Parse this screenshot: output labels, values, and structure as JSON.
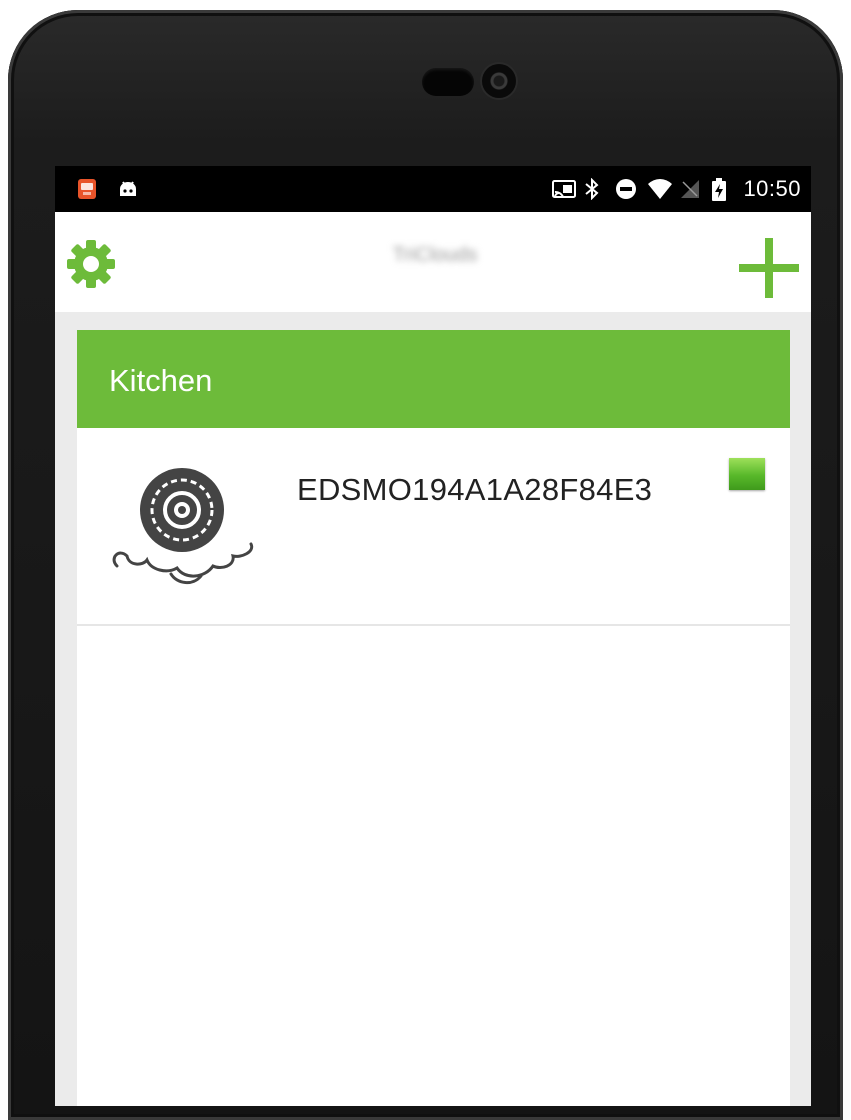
{
  "statusbar": {
    "left_icons": [
      "app-notification-icon",
      "android-debug-icon"
    ],
    "right_icons": [
      "cast-icon",
      "bluetooth-icon",
      "do-not-disturb-icon",
      "wifi-icon",
      "no-signal-icon",
      "battery-charging-icon"
    ],
    "time": "10:50"
  },
  "appbar": {
    "title": "TriClouds",
    "settings_icon": "gear-icon",
    "add_icon": "plus-icon",
    "accent_color": "#6dbb3a"
  },
  "groups": [
    {
      "name": "Kitchen",
      "header_color": "#6dbb3a",
      "devices": [
        {
          "name": "EDSMO194A1A28F84E3",
          "icon": "smoke-detector-icon",
          "status_color": "#58b82a"
        }
      ]
    }
  ]
}
